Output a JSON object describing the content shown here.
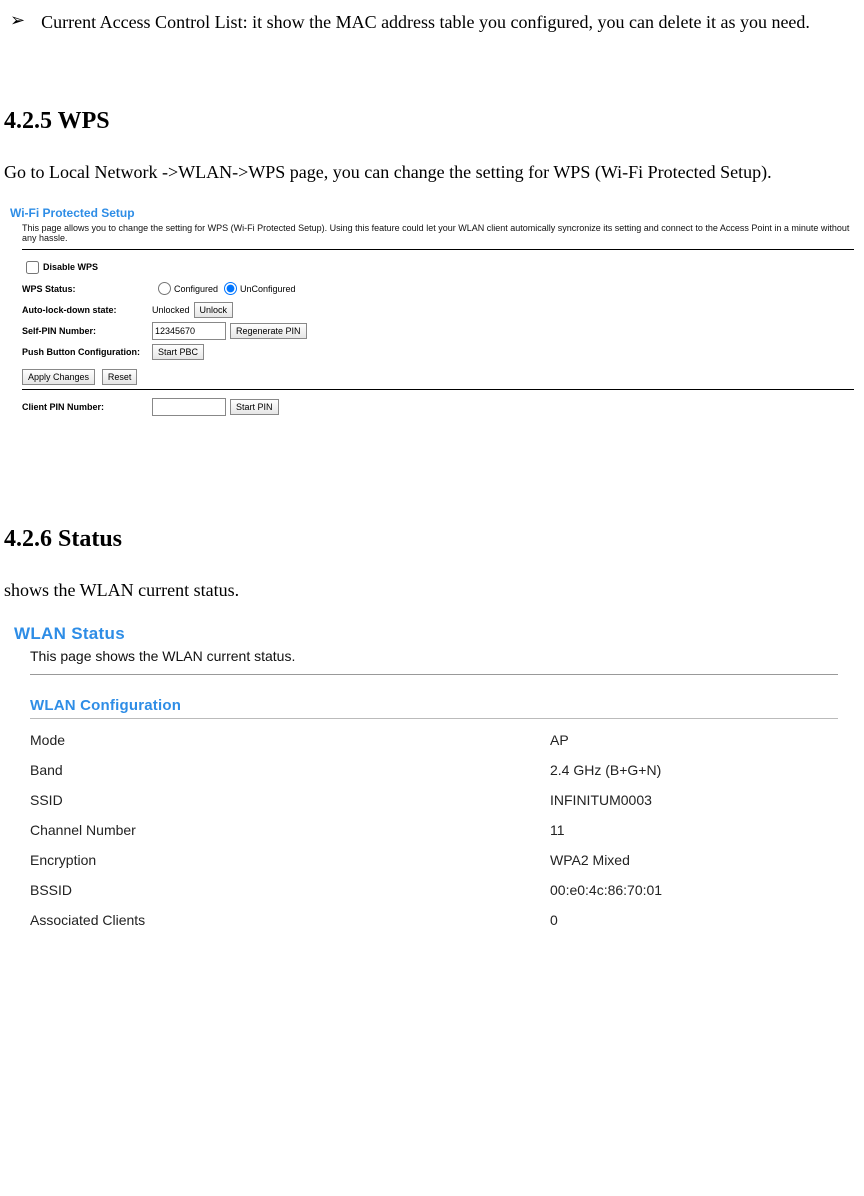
{
  "bullet": {
    "arrow": "➢",
    "text": "Current Access Control List: it show the MAC address table you configured, you can delete it as you need."
  },
  "sec1": {
    "heading": "4.2.5 WPS",
    "body": "Go to Local Network ->WLAN->WPS page, you can change the setting for WPS (Wi-Fi Protected Setup)."
  },
  "wps": {
    "title": "Wi-Fi Protected Setup",
    "descr": "This page allows you to change the setting for WPS (Wi-Fi Protected Setup). Using this feature could let your WLAN client automically syncronize its setting and connect to the Access Point in a minute without any hassle.",
    "disable_label": "Disable WPS",
    "status_label": "WPS Status:",
    "status_opt1": "Configured",
    "status_opt2": "UnConfigured",
    "lock_label": "Auto-lock-down state:",
    "lock_value": "Unlocked",
    "unlock_btn": "Unlock",
    "selfpin_label": "Self-PIN Number:",
    "selfpin_value": "12345670",
    "regen_btn": "Regenerate PIN",
    "pbc_label": "Push Button Configuration:",
    "pbc_btn": "Start PBC",
    "apply_btn": "Apply Changes",
    "reset_btn": "Reset",
    "clientpin_label": "Client PIN Number:",
    "clientpin_value": "",
    "startpin_btn": "Start PIN"
  },
  "sec2": {
    "heading": "4.2.6 Status",
    "body": "shows the WLAN current status."
  },
  "status": {
    "title": "WLAN Status",
    "descr": "This page shows the WLAN current status.",
    "subtitle": "WLAN Configuration",
    "rows": {
      "r0k": "Mode",
      "r0v": "AP",
      "r1k": "Band",
      "r1v": "2.4 GHz (B+G+N)",
      "r2k": "SSID",
      "r2v": "INFINITUM0003",
      "r3k": "Channel Number",
      "r3v": "11",
      "r4k": "Encryption",
      "r4v": "WPA2 Mixed",
      "r5k": "BSSID",
      "r5v": "00:e0:4c:86:70:01",
      "r6k": "Associated Clients",
      "r6v": "0"
    }
  }
}
